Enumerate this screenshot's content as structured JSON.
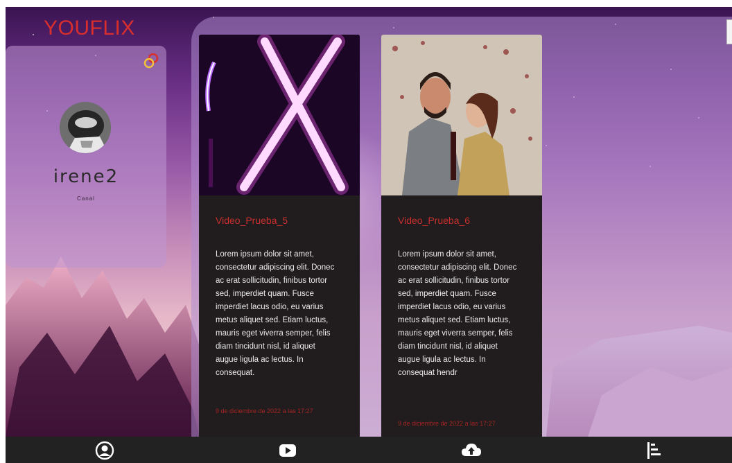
{
  "app": {
    "brand": "YOUFLIX"
  },
  "profile": {
    "username": "irene2",
    "subtitle": "Canal"
  },
  "videos": [
    {
      "title": "Video_Prueba_5",
      "description": "Lorem ipsum dolor sit amet, consectetur adipiscing elit. Donec ac erat sollicitudin, finibus tortor sed, imperdiet quam. Fusce imperdiet lacus odio, eu varius metus aliquet sed. Etiam luctus, mauris eget viverra semper, felis diam tincidunt nisl, id aliquet augue ligula ac lectus. In consequat.",
      "date": "9 de diciembre de 2022 a las 17:27",
      "thumbnail": "neon-x-image"
    },
    {
      "title": "Video_Prueba_6",
      "description": "Lorem ipsum dolor sit amet, consectetur adipiscing elit. Donec ac erat sollicitudin, finibus tortor sed, imperdiet quam. Fusce imperdiet lacus odio, eu varius metus aliquet sed. Etiam luctus, mauris eget viverra semper, felis diam tincidunt nisl, id aliquet augue ligula ac lectus. In consequat hendr",
      "date": "9 de diciembre de 2022 a las 17:27",
      "thumbnail": "couple-photo"
    }
  ],
  "nav": {
    "items": [
      {
        "icon": "user-circle-icon"
      },
      {
        "icon": "youtube-play-icon"
      },
      {
        "icon": "cloud-upload-icon"
      },
      {
        "icon": "list-tree-icon"
      }
    ]
  },
  "colors": {
    "brand": "#d92e2e",
    "card_bg": "#211c1e",
    "nav_bg": "#222222",
    "title_red": "#c9302c"
  }
}
